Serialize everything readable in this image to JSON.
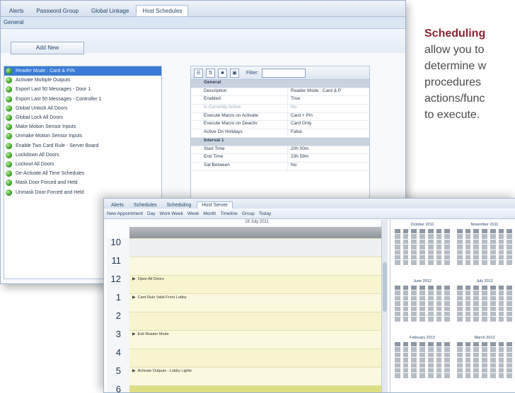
{
  "side_text": {
    "title": "Scheduling",
    "lines": [
      "allow you to",
      "determine w",
      "procedures",
      "actions/func",
      "to execute."
    ]
  },
  "back_window": {
    "tabs": [
      "Alerts ",
      "Password Group",
      "Global Linkage",
      "Host Schedules"
    ],
    "active_tab": 3,
    "subtab": "General",
    "add_button": "Add New",
    "procedures": [
      "Reader Mode : Card & PIN",
      "Activate Multiple Outputs",
      "Export Last 50 Messages - Door 1",
      "Export Last 50 Messages - Controller 1",
      "Global Unlock All Doors",
      "Global Lock All Doors",
      "Make Motion Sensor Inputs",
      "Unmake Motion Sensor Inputs",
      "Enable Two Card Rule - Server Board",
      "Lockdown All Doors",
      "Lockout All Doors",
      "De-Activate All Time Schedules",
      "Mask Door Forced and Held",
      "Unmask Door Forced and Held"
    ],
    "filter_label": "Filter:",
    "properties": [
      {
        "k": "General",
        "v": "",
        "cat": true
      },
      {
        "k": "Description",
        "v": "Reader Mode : Card & P"
      },
      {
        "k": "Enabled",
        "v": "True"
      },
      {
        "k": "Is Currently Active",
        "v": "No",
        "dim": true
      },
      {
        "k": "Execute Macro on Activate",
        "v": "Card + Pin"
      },
      {
        "k": "Execute Macro on Deactiv",
        "v": "Card Only"
      },
      {
        "k": "Active On Holidays",
        "v": "False"
      },
      {
        "k": "Interval 1",
        "v": "",
        "cat": true
      },
      {
        "k": "Start Time",
        "v": "20h 00m"
      },
      {
        "k": "End Time",
        "v": "23h 59m"
      },
      {
        "k": "Sat Between",
        "v": "No"
      }
    ]
  },
  "front_window": {
    "tabs": [
      "Alerts ",
      "Schedules",
      "Scheduling",
      "Host Server"
    ],
    "active_tab": 3,
    "toolbar": [
      "New Appointment",
      "Day",
      "Work Week",
      "Week",
      "Month",
      "Timeline",
      "Group",
      "Today"
    ],
    "date_heading": "18 July 2011",
    "hours": [
      "10",
      "11",
      "12",
      "1",
      "2",
      "3",
      "4",
      "5",
      "6"
    ],
    "events": [
      {
        "hour": "12",
        "text": "Open All Doors"
      },
      {
        "hour": "1",
        "text": "Card Rule Valid Front Lobby"
      },
      {
        "hour": "3",
        "text": "Exit Reader Mode"
      },
      {
        "hour": "5",
        "text": "Activate Outputs - Lobby Lights"
      }
    ],
    "months": [
      "October 2011",
      "November 2011",
      "June 2012",
      "July 2012",
      "February 2013",
      "March 2013"
    ]
  }
}
